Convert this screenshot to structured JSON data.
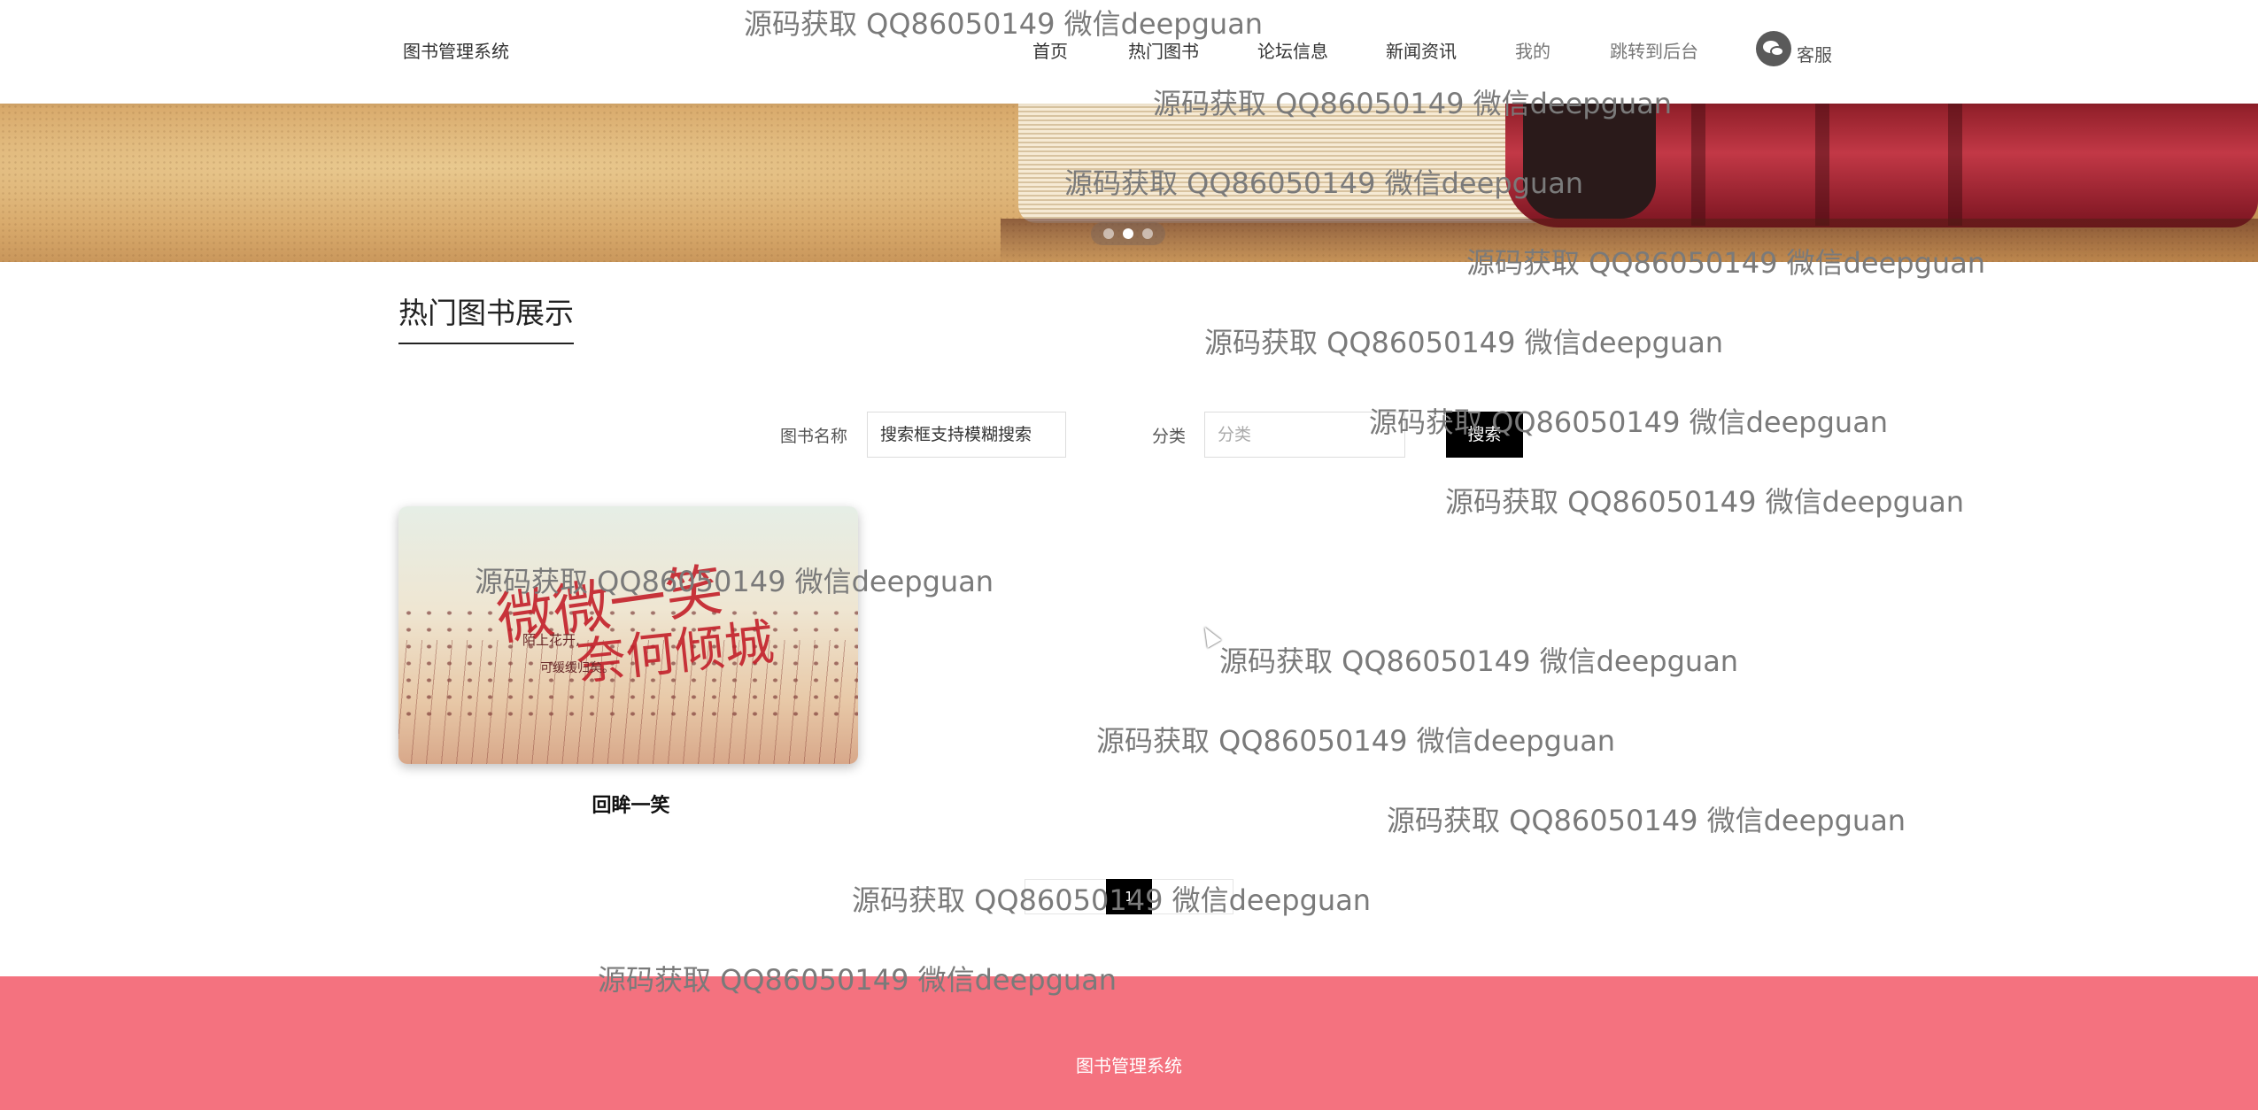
{
  "header": {
    "brand": "图书管理系统",
    "nav": [
      "首页",
      "热门图书",
      "论坛信息",
      "新闻资讯",
      "我的",
      "跳转到后台"
    ],
    "service_label": "客服",
    "service_icon": "wechat-icon"
  },
  "banner": {
    "slide_count": 3,
    "active_slide": 2
  },
  "section": {
    "title": "热门图书展示"
  },
  "search": {
    "name_label": "图书名称",
    "name_value": "搜索框支持模糊搜索",
    "category_label": "分类",
    "category_placeholder": "分类",
    "button_label": "搜索"
  },
  "books": [
    {
      "title": "回眸一笑",
      "cover_text_1": "陌上花开,",
      "cover_text_2": "可缓缓归矣。",
      "cover_calligraphy_1": "微微一笑",
      "cover_calligraphy_2": "奈何倾城"
    }
  ],
  "pagination": {
    "current": "1"
  },
  "footer": {
    "text": "图书管理系统"
  },
  "watermark": {
    "text": "源码获取 QQ86050149 微信deepguan"
  },
  "colors": {
    "footer": "#f4727f",
    "button": "#000000",
    "text": "#333333"
  }
}
